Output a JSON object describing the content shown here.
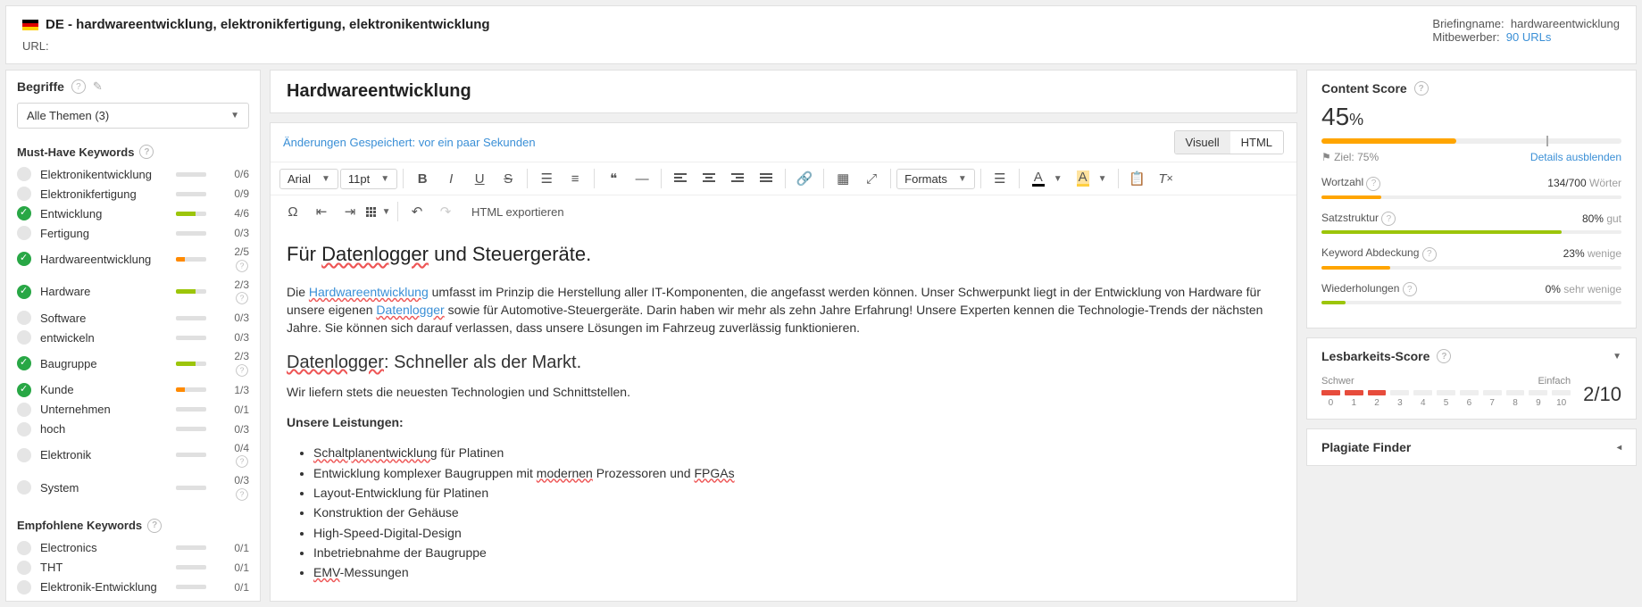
{
  "header": {
    "country": "DE",
    "title": "DE - hardwareentwicklung, elektronikfertigung, elektronikentwicklung",
    "url_label": "URL:",
    "briefing_label": "Briefingname:",
    "briefing_value": "hardwareentwicklung",
    "competitors_label": "Mitbewerber:",
    "competitors_value": "90 URLs"
  },
  "sidebar": {
    "title": "Begriffe",
    "dropdown": "Alle Themen (3)",
    "must_have_label": "Must-Have Keywords",
    "recommended_label": "Empfohlene Keywords",
    "must_have": [
      {
        "name": "Elektronikentwicklung",
        "done": false,
        "bar": "",
        "ratio": "0/6"
      },
      {
        "name": "Elektronikfertigung",
        "done": false,
        "bar": "",
        "ratio": "0/9"
      },
      {
        "name": "Entwicklung",
        "done": true,
        "bar": "g",
        "ratio": "4/6"
      },
      {
        "name": "Fertigung",
        "done": false,
        "bar": "",
        "ratio": "0/3"
      },
      {
        "name": "Hardwareentwicklung",
        "done": true,
        "bar": "o",
        "ratio": "2/5",
        "info": true
      },
      {
        "name": "Hardware",
        "done": true,
        "bar": "g",
        "ratio": "2/3",
        "info": true
      },
      {
        "name": "Software",
        "done": false,
        "bar": "",
        "ratio": "0/3"
      },
      {
        "name": "entwickeln",
        "done": false,
        "bar": "",
        "ratio": "0/3"
      },
      {
        "name": "Baugruppe",
        "done": true,
        "bar": "g",
        "ratio": "2/3",
        "info": true
      },
      {
        "name": "Kunde",
        "done": true,
        "bar": "o",
        "ratio": "1/3"
      },
      {
        "name": "Unternehmen",
        "done": false,
        "bar": "",
        "ratio": "0/1"
      },
      {
        "name": "hoch",
        "done": false,
        "bar": "",
        "ratio": "0/3"
      },
      {
        "name": "Elektronik",
        "done": false,
        "bar": "",
        "ratio": "0/4",
        "info": true
      },
      {
        "name": "System",
        "done": false,
        "bar": "",
        "ratio": "0/3",
        "info": true
      }
    ],
    "recommended": [
      {
        "name": "Electronics",
        "done": false,
        "bar": "",
        "ratio": "0/1"
      },
      {
        "name": "THT",
        "done": false,
        "bar": "",
        "ratio": "0/1"
      },
      {
        "name": "Elektronik-Entwicklung",
        "done": false,
        "bar": "",
        "ratio": "0/1"
      }
    ]
  },
  "editor": {
    "heading": "Hardwareentwicklung",
    "save_msg": "Änderungen Gespeichert: vor ein paar Sekunden",
    "tabs": {
      "visual": "Visuell",
      "html": "HTML"
    },
    "font": "Arial",
    "size": "11pt",
    "formats": "Formats",
    "export": "HTML exportieren",
    "content": {
      "h2a": "Für ",
      "h2b": "Datenlogger",
      "h2c": " und Steuergeräte.",
      "p1a": "Die ",
      "p1b": "Hardwareentwicklung",
      "p1c": " umfasst im Prinzip die Herstellung aller IT-Komponenten, die angefasst werden können. Unser Schwerpunkt liegt in der Entwicklung von Hardware für unsere eigenen ",
      "p1d": "Datenlogger",
      "p1e": " sowie für Automotive-Steuergeräte. Darin haben wir mehr als zehn Jahre Erfahrung! Unsere Experten kennen die Technologie-Trends der nächsten Jahre. Sie können sich darauf verlassen, dass unsere Lösungen im Fahrzeug zuverlässig funktionieren.",
      "h3a": "Datenlogger",
      "h3b": ": Schneller als der Markt.",
      "p2": "Wir liefern stets die neuesten Technologien und Schnittstellen.",
      "strong": "Unsere Leistungen:",
      "li1a": "Schaltplanentwicklung",
      "li1b": " für Platinen",
      "li2a": "Entwicklung komplexer Baugruppen mit ",
      "li2b": "modernen",
      "li2c": " Prozessoren und ",
      "li2d": "FPGAs",
      "li3": "Layout-Entwicklung für Platinen",
      "li4": "Konstruktion der Gehäuse",
      "li5": "High-Speed-Digital-Design",
      "li6": "Inbetriebnahme der Baugruppe",
      "li7a": "EMV",
      "li7b": "-Messungen"
    }
  },
  "score": {
    "title": "Content Score",
    "value": "45",
    "pct": "%",
    "goal_label": "Ziel: 75%",
    "details": "Details ausblenden",
    "metrics": [
      {
        "label": "Wortzahl",
        "value": "134/700",
        "tag": "Wörter",
        "fill": 20,
        "color": "#ffa500"
      },
      {
        "label": "Satzstruktur",
        "value": "80%",
        "tag": "gut",
        "fill": 80,
        "color": "#9cc50a"
      },
      {
        "label": "Keyword Abdeckung",
        "value": "23%",
        "tag": "wenige",
        "fill": 23,
        "color": "#ffa500"
      },
      {
        "label": "Wiederholungen",
        "value": "0%",
        "tag": "sehr wenige",
        "fill": 8,
        "color": "#9cc50a"
      }
    ]
  },
  "readability": {
    "title": "Lesbarkeits-Score",
    "hard": "Schwer",
    "easy": "Einfach",
    "score": "2/10",
    "segments": [
      true,
      true,
      true,
      false,
      false,
      false,
      false,
      false,
      false,
      false,
      false
    ],
    "numbers": [
      "0",
      "1",
      "2",
      "3",
      "4",
      "5",
      "6",
      "7",
      "8",
      "9",
      "10"
    ]
  },
  "plagiarism": {
    "title": "Plagiate Finder"
  }
}
